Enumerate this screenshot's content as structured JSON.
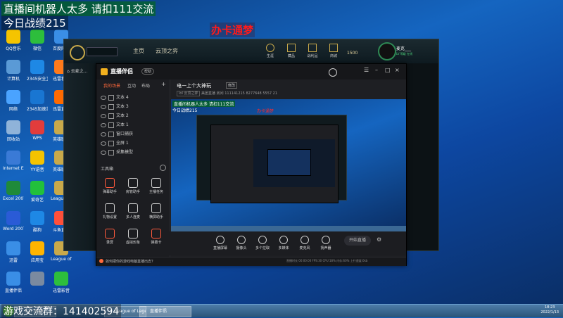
{
  "overlay": {
    "top_banner": "直播间机器人太多 请扣111交流",
    "record": "今日战绩215",
    "bottom_banner": "游戏交流群：141402594",
    "red_label": "办卡通梦"
  },
  "desktop_icons": [
    {
      "label": "QQ音乐",
      "color": "#f5c400"
    },
    {
      "label": "微信",
      "color": "#2dbe3c"
    },
    {
      "label": "百度网盘",
      "color": "#3a8ee6"
    },
    {
      "label": "计算机",
      "color": "#5a9ad6"
    },
    {
      "label": "2345安全卫士",
      "color": "#1e88e5"
    },
    {
      "label": "迅雷看看",
      "color": "#ff7a1a"
    },
    {
      "label": "网络",
      "color": "#4aa3ff"
    },
    {
      "label": "2345加速浏览器",
      "color": "#1976d2"
    },
    {
      "label": "迅雷直播",
      "color": "#ff6a00"
    },
    {
      "label": "回收站",
      "color": "#8fb3d9"
    },
    {
      "label": "WPS",
      "color": "#e23c3c"
    },
    {
      "label": "英雄联盟",
      "color": "#c9a94a"
    },
    {
      "label": "Internet Explorer",
      "color": "#3a7ad6"
    },
    {
      "label": "YY语音",
      "color": "#f4c300"
    },
    {
      "label": "英雄联盟",
      "color": "#c9a94a"
    },
    {
      "label": "Excel 2007",
      "color": "#1f8a3a"
    },
    {
      "label": "爱奇艺",
      "color": "#22c03c"
    },
    {
      "label": "League of Legends",
      "color": "#c9a94a"
    },
    {
      "label": "Word 2007",
      "color": "#2a5bd6"
    },
    {
      "label": "酷狗",
      "color": "#1e88e5"
    },
    {
      "label": "斗鱼直播",
      "color": "#ff4f3a"
    },
    {
      "label": "迅雷",
      "color": "#3a8ee6"
    },
    {
      "label": "应用宝",
      "color": "#ffb400"
    },
    {
      "label": "League of Legends",
      "color": "#c9a94a"
    },
    {
      "label": "直播伴侣",
      "color": "#3a8ee6"
    },
    {
      "label": "",
      "color": "#7a8aa0"
    },
    {
      "label": "迅雷影音",
      "color": "#2dbe3c"
    }
  ],
  "game": {
    "search_placeholder": "",
    "nav": [
      "主页",
      "云顶之弈"
    ],
    "menu": [
      "生涯",
      "藏品",
      "战利品",
      "商城"
    ],
    "currency": "1500",
    "username": "麦克___",
    "status": "LV 等级 在线",
    "side_title": "云麦之..."
  },
  "tool": {
    "logo": "直播伴侣",
    "badge": "帮助",
    "title": "电一上个大神玩",
    "title_tag": "修改",
    "meta": [
      "lol 云顶之弈",
      "美团直播",
      "房间 111141215",
      "8277648",
      "5557",
      "21"
    ],
    "tabs": [
      "我的场景",
      "互动",
      "布局"
    ],
    "scenes": [
      "文本 4",
      "文本 3",
      "文本 2",
      "文本 1",
      "窗口捕获",
      "全屏 1",
      "采集模型"
    ],
    "tools_header": "工具箱",
    "tools": [
      "弹幕助手",
      "房管助手",
      "主播任务",
      "礼物设置",
      "多人连麦",
      "横屏助手",
      "录屏",
      "虚拟形象",
      "弹幕卡"
    ],
    "bottom_buttons": [
      "直播屏幕",
      "摄像头",
      "多个拉取",
      "多媒体",
      "麦克风",
      "扬声器"
    ],
    "start_label": "开始直播",
    "status_bar": "如何把你的游戏电脑直播出去？",
    "status_stats": [
      "直播时长 00:00:00",
      "FPS:30",
      "CPU:18%",
      "内存:60%",
      "上行速度:0kb"
    ]
  },
  "preview": {
    "overlay_text": "直播间机器人太多 请扣111交流",
    "record": "今日战绩215",
    "red_label": "办卡通梦"
  },
  "taskbar": {
    "tasks": [
      "8277648",
      "League of Legends",
      "直播伴侣"
    ],
    "time": "18:23",
    "date": "2022/1/13"
  }
}
